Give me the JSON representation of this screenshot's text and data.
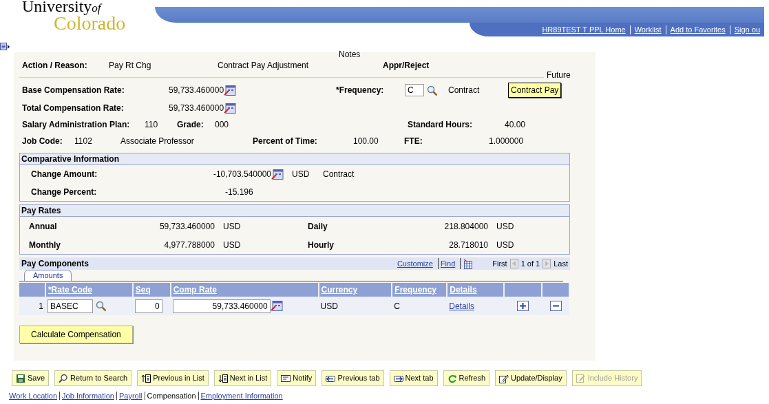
{
  "logo": {
    "line1": "University",
    "of": "of",
    "line2": "Colorado"
  },
  "header_links": [
    "HR89TEST T  PPL Home",
    "Worklist",
    "Add to Favorites",
    "Sign ou"
  ],
  "action_row": {
    "label": "Action / Reason:",
    "action": "Pay Rt Chg",
    "reason": "Contract Pay Adjustment",
    "notes": "Notes",
    "appr": "Appr/Reject"
  },
  "future": "Future",
  "rows": [
    [
      {
        "kind": "label",
        "text": "Base Compensation Rate:"
      },
      {
        "kind": "calc",
        "text": "59,733.460000"
      },
      {
        "kind": "label",
        "text": "*Frequency:"
      },
      {
        "kind": "input",
        "text": "C"
      },
      {
        "kind": "lookup"
      },
      {
        "kind": "value",
        "text": "Contract"
      },
      {
        "kind": "button",
        "text": "Contract Pay"
      }
    ],
    [
      {
        "kind": "label",
        "text": "Total Compensation Rate:"
      },
      {
        "kind": "calc",
        "text": "59,733.460000"
      }
    ],
    [
      {
        "kind": "label",
        "text": "Salary Administration Plan:"
      },
      {
        "kind": "value",
        "text": "110"
      },
      {
        "kind": "label",
        "text": "Grade:"
      },
      {
        "kind": "value",
        "text": "000"
      },
      {
        "kind": "label",
        "text": "Standard Hours:"
      },
      {
        "kind": "value",
        "text": "40.00"
      }
    ],
    [
      {
        "kind": "label",
        "text": "Job Code:"
      },
      {
        "kind": "value",
        "text": "1102"
      },
      {
        "kind": "value",
        "text": "Associate Professor"
      },
      {
        "kind": "label",
        "text": "Percent of Time:"
      },
      {
        "kind": "value",
        "text": "100.00"
      },
      {
        "kind": "label",
        "text": "FTE:"
      },
      {
        "kind": "value",
        "text": "1.000000"
      }
    ]
  ],
  "comparative": {
    "title": "Comparative Information",
    "change_amount_label": "Change Amount:",
    "change_amount": "-10,703.540000",
    "currency": "USD",
    "frequency": "Contract",
    "change_percent_label": "Change Percent:",
    "change_percent": "-15.196"
  },
  "pay_rates": {
    "title": "Pay Rates",
    "rows": [
      {
        "label": "Annual",
        "value": "59,733.460000",
        "currency": "USD",
        "label2": "Daily",
        "value2": "218.804000",
        "currency2": "USD"
      },
      {
        "label": "Monthly",
        "value": "4,977.788000",
        "currency": "USD",
        "label2": "Hourly",
        "value2": "28.718010",
        "currency2": "USD"
      }
    ]
  },
  "pay_components": {
    "title": "Pay Components",
    "links": [
      "Customize",
      "Find"
    ],
    "first": "First",
    "count": "1 of 1",
    "last": "Last",
    "tabs": [
      {
        "label": "Amounts",
        "selected": true
      }
    ],
    "columns": [
      "*Rate Code",
      "Seq",
      "Comp Rate",
      "Currency",
      "Frequency",
      "Details"
    ],
    "rows": [
      {
        "num": "1",
        "rate_code": "BASEC",
        "seq": "0",
        "comp_rate": "59,733.460000",
        "currency": "USD",
        "frequency": "C",
        "details": "Details"
      }
    ]
  },
  "calculate_button": "Calculate Compensation",
  "toolbar": [
    {
      "kind": "save",
      "label": "Save",
      "disabled": false
    },
    {
      "kind": "search",
      "label": "Return to Search",
      "disabled": false
    },
    {
      "kind": "prev-list",
      "label": "Previous in List",
      "disabled": false
    },
    {
      "kind": "next-list",
      "label": "Next in List",
      "disabled": false
    },
    {
      "kind": "notify",
      "label": "Notify",
      "disabled": false
    },
    {
      "kind": "prev-tab",
      "label": "Previous tab",
      "disabled": false
    },
    {
      "kind": "next-tab",
      "label": "Next tab",
      "disabled": false
    },
    {
      "kind": "refresh",
      "label": "Refresh",
      "disabled": false
    },
    {
      "kind": "update",
      "label": "Update/Display",
      "disabled": false
    },
    {
      "kind": "history",
      "label": "Include History",
      "disabled": true
    }
  ],
  "footer_links": [
    {
      "label": "Work Location",
      "selected": false
    },
    {
      "label": "Job Information",
      "selected": false
    },
    {
      "label": "Payroll",
      "selected": false
    },
    {
      "label": "Compensation",
      "selected": true
    },
    {
      "label": "Employment Information",
      "selected": false
    }
  ]
}
